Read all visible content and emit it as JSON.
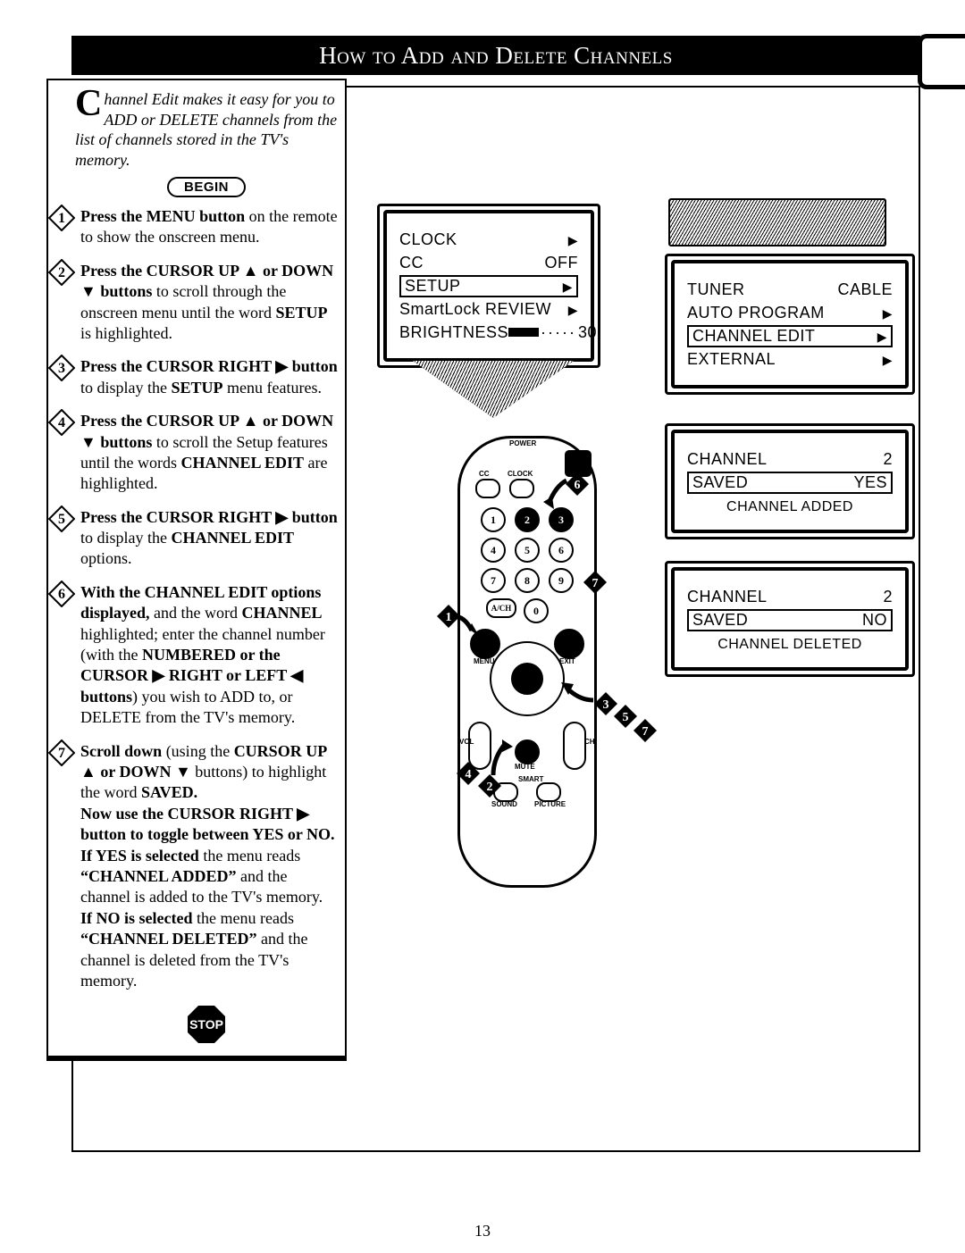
{
  "header": {
    "title": "How to Add and Delete Channels"
  },
  "intro": {
    "dropcap": "C",
    "text": "hannel Edit makes it easy for you to ADD or DELETE channels from the list of channels stored in the TV's memory."
  },
  "pills": {
    "begin": "BEGIN",
    "stop": "STOP"
  },
  "steps": {
    "s1": {
      "lead": "Press the MENU button",
      "rest": " on the remote to show the onscreen menu."
    },
    "s2": {
      "lead": "Press the CURSOR UP ▲ or DOWN ▼ buttons",
      "rest": " to scroll through the onscreen menu until the word ",
      "hl": "SETUP",
      "rest2": " is highlighted."
    },
    "s3": {
      "lead": "Press the CURSOR RIGHT ▶ button",
      "rest": " to display the ",
      "hl": "SETUP",
      "rest2": " menu features."
    },
    "s4": {
      "lead": "Press the CURSOR UP ▲ or DOWN ▼ buttons",
      "rest": " to scroll the Setup features until the words ",
      "hl": "CHANNEL EDIT",
      "rest2": " are highlighted."
    },
    "s5": {
      "lead": "Press the CURSOR RIGHT ▶ button",
      "rest": " to display the ",
      "hl": "CHANNEL EDIT",
      "rest2": " options."
    },
    "s6": {
      "lead": "With the CHANNEL EDIT options displayed,",
      "rest": " and the word ",
      "hl1": "CHANNEL",
      "rest2": " highlighted; enter the channel number (with the ",
      "hl2": "NUMBERED or the CURSOR ▶ RIGHT or LEFT ◀ buttons",
      "rest3": ") you wish to ADD to, or DELETE from the TV's memory."
    },
    "s7": {
      "lead": "Scroll down",
      "rest": " (using the ",
      "hl1": "CURSOR UP ▲ or DOWN ▼",
      "rest2": " buttons) to highlight the word ",
      "hl2": "SAVED.",
      "line2a": "Now use the CURSOR RIGHT ▶ button to toggle between YES or NO.",
      "line3a": "If YES is selected",
      "line3b": " the menu reads ",
      "q1": "“CHANNEL ADDED”",
      "line3c": " and the channel is added to the TV's memory. ",
      "line4a": "If NO is selected",
      "line4b": " the menu reads ",
      "q2": "“CHANNEL DELETED”",
      "line4c": " and the channel is deleted from the TV's memory."
    }
  },
  "osd_main": {
    "clock": "CLOCK",
    "cc": "CC",
    "cc_val": "OFF",
    "setup": "SETUP",
    "smartlock": "SmartLock REVIEW",
    "brightness": "BRIGHTNESS",
    "brightness_val": "30"
  },
  "osd_tuner": {
    "tuner": "TUNER",
    "tuner_val": "CABLE",
    "auto": "AUTO PROGRAM",
    "edit": "CHANNEL EDIT",
    "external": "EXTERNAL"
  },
  "osd_add": {
    "channel": "CHANNEL",
    "channel_val": "2",
    "saved": "SAVED",
    "saved_val": "YES",
    "status": "CHANNEL ADDED"
  },
  "osd_del": {
    "channel": "CHANNEL",
    "channel_val": "2",
    "saved": "SAVED",
    "saved_val": "NO",
    "status": "CHANNEL DELETED"
  },
  "remote": {
    "labels": {
      "power": "POWER",
      "cc": "CC",
      "clock": "CLOCK",
      "vol": "VOL",
      "ch": "CH",
      "mute": "MUTE",
      "menu": "MENU",
      "exit": "EXIT",
      "sound": "SOUND",
      "picture": "PICTURE",
      "smart": "SMART",
      "ach": "A/CH"
    },
    "nums": {
      "n1": "1",
      "n2": "2",
      "n3": "3",
      "n4": "4",
      "n5": "5",
      "n6": "6",
      "n7": "7",
      "n8": "8",
      "n9": "9",
      "n0": "0"
    }
  },
  "pagenum": "13"
}
